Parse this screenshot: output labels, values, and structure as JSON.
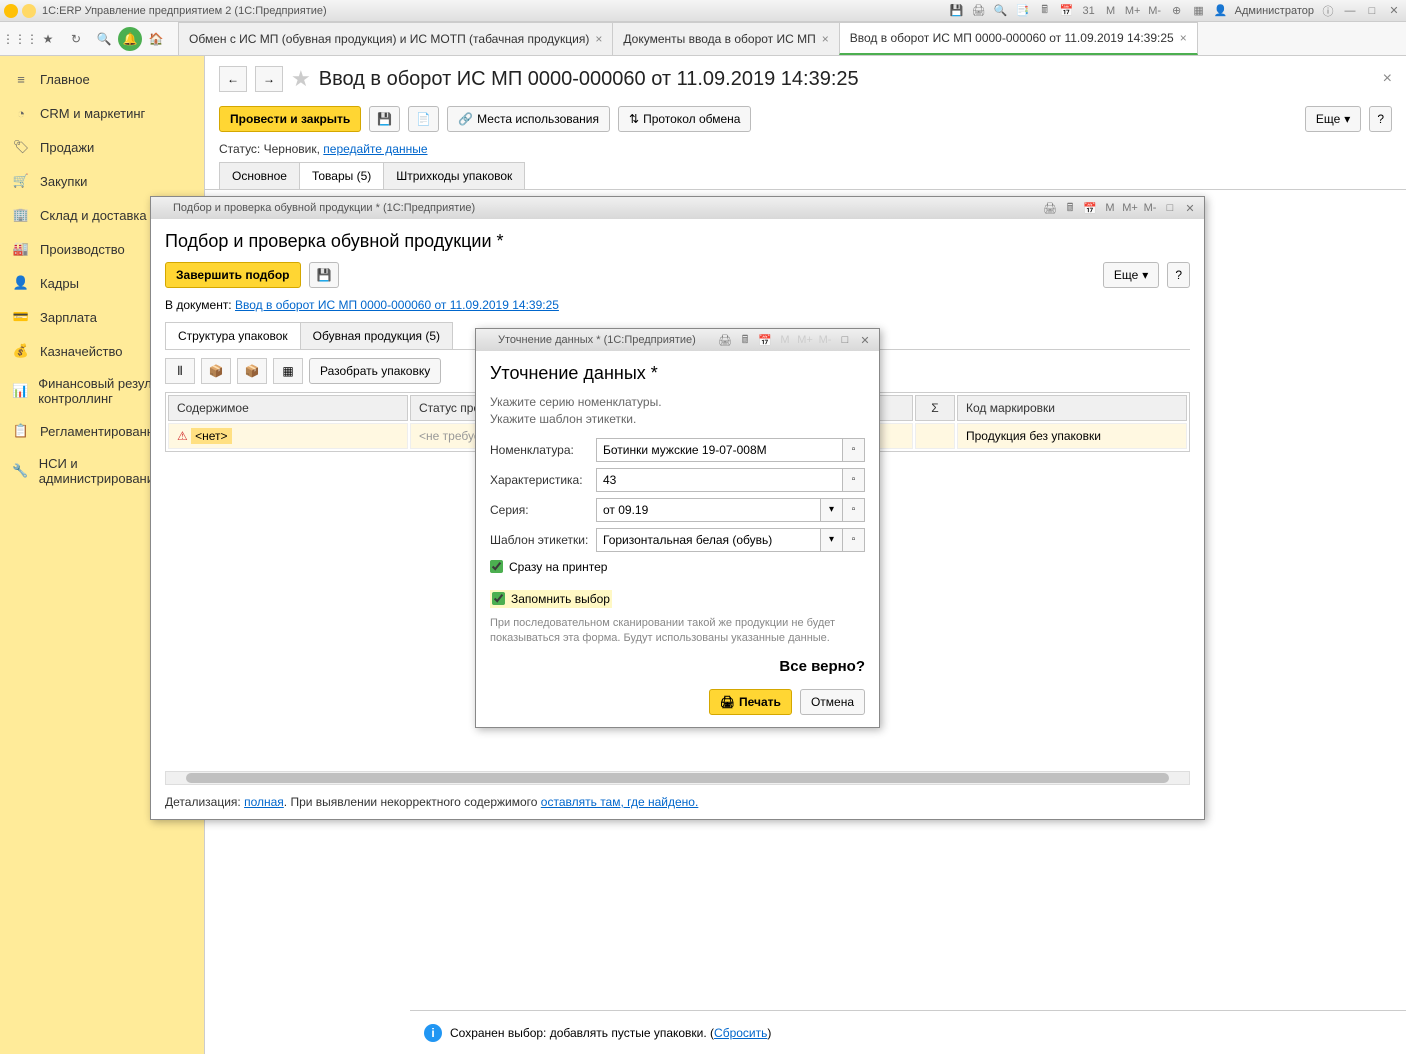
{
  "app": {
    "title": "1С:ERP Управление предприятием 2  (1С:Предприятие)",
    "user": "Администратор"
  },
  "sidebar": {
    "items": [
      {
        "label": "Главное",
        "icon": "≡"
      },
      {
        "label": "CRM и маркетинг",
        "icon": "◔"
      },
      {
        "label": "Продажи",
        "icon": "🏷"
      },
      {
        "label": "Закупки",
        "icon": "🛒"
      },
      {
        "label": "Склад и доставка",
        "icon": "🏢"
      },
      {
        "label": "Производство",
        "icon": "🏭"
      },
      {
        "label": "Кадры",
        "icon": "👤"
      },
      {
        "label": "Зарплата",
        "icon": "💳"
      },
      {
        "label": "Казначейство",
        "icon": "💰"
      },
      {
        "label": "Финансовый результат и контроллинг",
        "icon": "📊"
      },
      {
        "label": "Регламентированный",
        "icon": "📋"
      },
      {
        "label": "НСИ и администрирование",
        "icon": "🔧"
      }
    ]
  },
  "tabs": [
    {
      "label": "Обмен с ИС МП (обувная продукция) и ИС МОТП (табачная продукция)"
    },
    {
      "label": "Документы ввода в оборот ИС МП"
    },
    {
      "label": "Ввод в оборот ИС МП 0000-000060 от 11.09.2019 14:39:25",
      "active": true
    }
  ],
  "doc": {
    "title": "Ввод в оборот ИС МП 0000-000060 от 11.09.2019 14:39:25",
    "post_close": "Провести и закрыть",
    "usage": "Места использования",
    "protocol": "Протокол обмена",
    "more": "Еще",
    "status_label": "Статус:",
    "status_val": "Черновик,",
    "status_link": "передайте данные",
    "tabs": [
      "Основное",
      "Товары (5)",
      "Штрихкоды упаковок"
    ]
  },
  "modal1": {
    "wintitle": "Подбор и проверка обувной продукции *  (1С:Предприятие)",
    "title": "Подбор и проверка обувной продукции *",
    "finish": "Завершить подбор",
    "more": "Еще",
    "docline_label": "В документ:",
    "docline_link": "Ввод в оборот ИС МП 0000-000060 от 11.09.2019 14:39:25",
    "tabs": [
      "Структура упаковок",
      "Обувная продукция (5)"
    ],
    "unpack": "Разобрать упаковку",
    "cols": {
      "c1": "Содержимое",
      "c2": "Статус проверки",
      "c3": "Σ",
      "c4": "Код маркировки"
    },
    "row": {
      "c1": "<нет>",
      "c2": "<не требуется>",
      "c4": "Продукция без упаковки"
    },
    "det_label": "Детализация:",
    "det_link1": "полная",
    "det_mid": ". При выявлении некорректного содержимого ",
    "det_link2": "оставлять там, где найдено."
  },
  "modal2": {
    "wintitle": "Уточнение данных *  (1С:Предприятие)",
    "title": "Уточнение данных *",
    "hint1": "Укажите серию номенклатуры.",
    "hint2": "Укажите шаблон этикетки.",
    "f_nomen_label": "Номенклатура:",
    "f_nomen_val": "Ботинки мужские 19-07-008М",
    "f_char_label": "Характеристика:",
    "f_char_val": "43",
    "f_series_label": "Серия:",
    "f_series_val": "от 09.19",
    "f_tmpl_label": "Шаблон этикетки:",
    "f_tmpl_val": "Горизонтальная белая (обувь)",
    "chk1": "Сразу на принтер",
    "chk2": "Запомнить выбор",
    "note": "При последовательном сканировании такой же продукции не будет показываться эта форма. Будут использованы указанные данные.",
    "confirm": "Все верно?",
    "print": "Печать",
    "cancel": "Отмена"
  },
  "statusbar": {
    "text": "Сохранен выбор: добавлять пустые упаковки. (",
    "link": "Сбросить",
    "text2": ")"
  }
}
